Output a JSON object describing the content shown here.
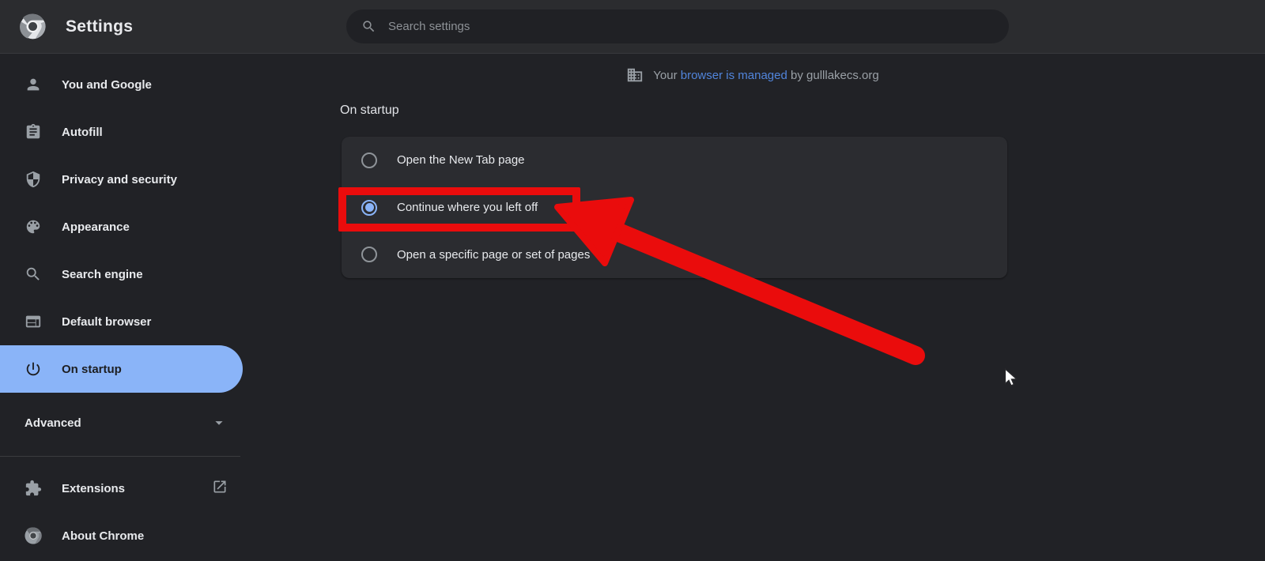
{
  "header": {
    "title": "Settings",
    "search_placeholder": "Search settings"
  },
  "sidebar": {
    "items": [
      {
        "label": "You and Google",
        "icon": "person-icon"
      },
      {
        "label": "Autofill",
        "icon": "clipboard-icon"
      },
      {
        "label": "Privacy and security",
        "icon": "shield-icon"
      },
      {
        "label": "Appearance",
        "icon": "palette-icon"
      },
      {
        "label": "Search engine",
        "icon": "search-icon"
      },
      {
        "label": "Default browser",
        "icon": "browser-window-icon"
      },
      {
        "label": "On startup",
        "icon": "power-icon",
        "active": true
      }
    ],
    "advanced_label": "Advanced",
    "extensions_label": "Extensions",
    "about_label": "About Chrome"
  },
  "managed_notice": {
    "prefix": "Your ",
    "link_text": "browser is managed",
    "suffix": " by gulllakecs.org"
  },
  "main": {
    "section_title": "On startup",
    "options": [
      {
        "label": "Open the New Tab page",
        "selected": false
      },
      {
        "label": "Continue where you left off",
        "selected": true
      },
      {
        "label": "Open a specific page or set of pages",
        "selected": false
      }
    ]
  },
  "annotations": {
    "highlight_color": "#ea0c0c",
    "highlighted_option": "Continue where you left off"
  },
  "colors": {
    "accent_blue": "#8ab4f8",
    "link_blue": "#5185dc",
    "toolbar_bg": "#2b2c2f",
    "page_bg": "#212226",
    "card_bg": "#2b2c30"
  }
}
